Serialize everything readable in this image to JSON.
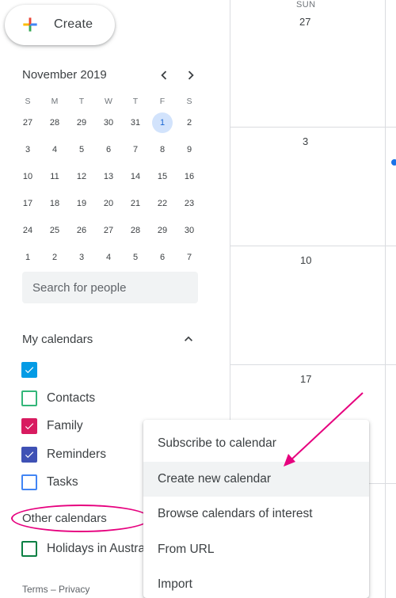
{
  "create_button": {
    "label": "Create"
  },
  "mini_calendar": {
    "month_title": "November 2019",
    "weekdays": [
      "S",
      "M",
      "T",
      "W",
      "T",
      "F",
      "S"
    ],
    "weeks": [
      [
        "27",
        "28",
        "29",
        "30",
        "31",
        "1",
        "2"
      ],
      [
        "3",
        "4",
        "5",
        "6",
        "7",
        "8",
        "9"
      ],
      [
        "10",
        "11",
        "12",
        "13",
        "14",
        "15",
        "16"
      ],
      [
        "17",
        "18",
        "19",
        "20",
        "21",
        "22",
        "23"
      ],
      [
        "24",
        "25",
        "26",
        "27",
        "28",
        "29",
        "30"
      ],
      [
        "1",
        "2",
        "3",
        "4",
        "5",
        "6",
        "7"
      ]
    ],
    "selected_day": "1"
  },
  "search": {
    "placeholder": "Search for people"
  },
  "my_calendars": {
    "title": "My calendars",
    "items": [
      {
        "label": "",
        "color": "#039be5",
        "checked": true
      },
      {
        "label": "Contacts",
        "color": "#33b679",
        "checked": false
      },
      {
        "label": "Family",
        "color": "#d81b60",
        "checked": true
      },
      {
        "label": "Reminders",
        "color": "#3f51b5",
        "checked": true
      },
      {
        "label": "Tasks",
        "color": "#4285f4",
        "checked": false
      }
    ]
  },
  "other_calendars": {
    "title": "Other calendars",
    "items": [
      {
        "label": "Holidays in Austra",
        "color": "#0b8043",
        "checked": false
      }
    ]
  },
  "footer": {
    "terms": "Terms",
    "separator": "–",
    "privacy": "Privacy"
  },
  "grid": {
    "day_of_week": "SUN",
    "dates": [
      "27",
      "3",
      "10",
      "17"
    ]
  },
  "context_menu": {
    "items": [
      "Subscribe to calendar",
      "Create new calendar",
      "Browse calendars of interest",
      "From URL",
      "Import"
    ],
    "highlighted": "Create new calendar"
  },
  "colors": {
    "accent_blue": "#1a73e8",
    "selected_day_bg": "#d2e3fc",
    "annotation_magenta": "#e6007e"
  }
}
